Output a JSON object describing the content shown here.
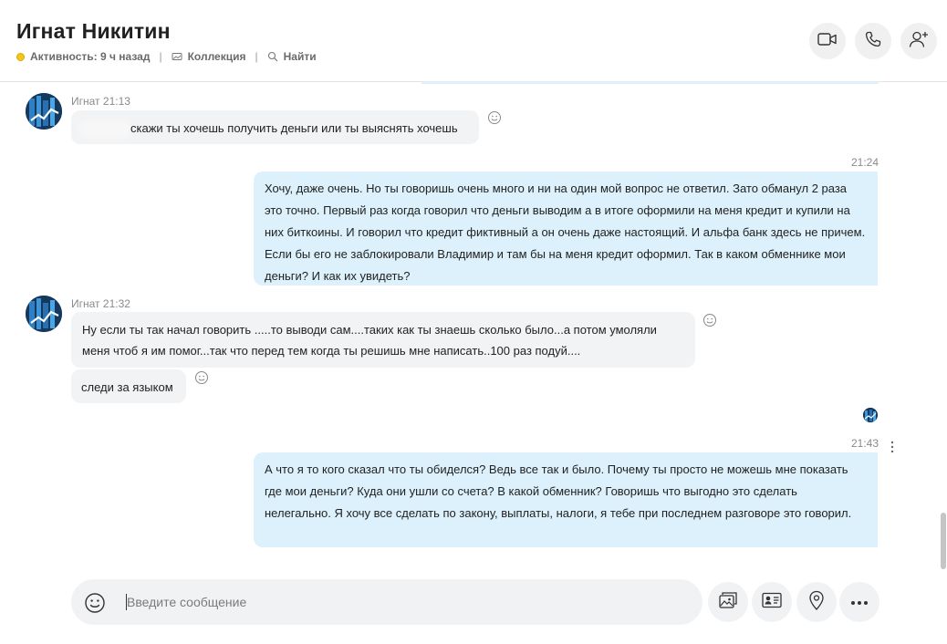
{
  "header": {
    "contact_name": "Игнат Никитин",
    "activity": "Активность: 9 ч назад",
    "collection": "Коллекция",
    "find": "Найти",
    "separator": "|",
    "status_color": "#f5c518"
  },
  "messages": [
    {
      "direction": "in",
      "sender": "Игнат",
      "time": "21:13",
      "text": "скажи  ты хочешь получить деньги или ты выяснять хочешь"
    },
    {
      "direction": "out",
      "time": "21:24",
      "text": "Хочу, даже очень. Но ты говоришь очень много и ни на один мой вопрос не ответил. Зато обманул 2 раза это точно. Первый раз когда говорил что деньги выводим а в итоге оформили на меня кредит и купили на них биткоины. И говорил что кредит фиктивный а он очень даже настоящий. И альфа банк здесь не причем. Если бы его не заблокировали Владимир и там бы на меня кредит оформил. Так в каком обменнике мои деньги? И как их увидеть?"
    },
    {
      "direction": "in",
      "sender": "Игнат",
      "time": "21:32",
      "text": "Ну если ты так начал говорить .....то выводи сам....таких как ты знаешь сколько было...а потом умоляли меня чтоб я им помог...так что перед тем когда ты решишь мне написать..100 раз подуй...."
    },
    {
      "direction": "in",
      "text": "следи за языком"
    },
    {
      "direction": "out",
      "time": "21:43",
      "text": "А что я то кого сказал что ты обиделся? Ведь все так и было. Почему ты просто не можешь мне показать где мои деньги? Куда они ушли со счета? В какой обменник? Говоришь что выгодно это сделать нелегально. Я хочу все сделать по закону, выплаты, налоги, я тебе при последнем разговоре это говорил."
    }
  ],
  "composer": {
    "placeholder": "Введите сообщение"
  },
  "icons": {
    "video_call": "video-camera-icon",
    "audio_call": "phone-icon",
    "add_people": "add-person-icon",
    "emoji": "smiley-icon",
    "media": "image-gallery-icon",
    "contact_card": "contact-card-icon",
    "location": "location-pin-icon",
    "more": "more-horizontal-icon"
  },
  "colors": {
    "outgoing_bubble": "#dcf1fb",
    "incoming_bubble": "#f2f3f5",
    "accent": "#0078d4"
  }
}
